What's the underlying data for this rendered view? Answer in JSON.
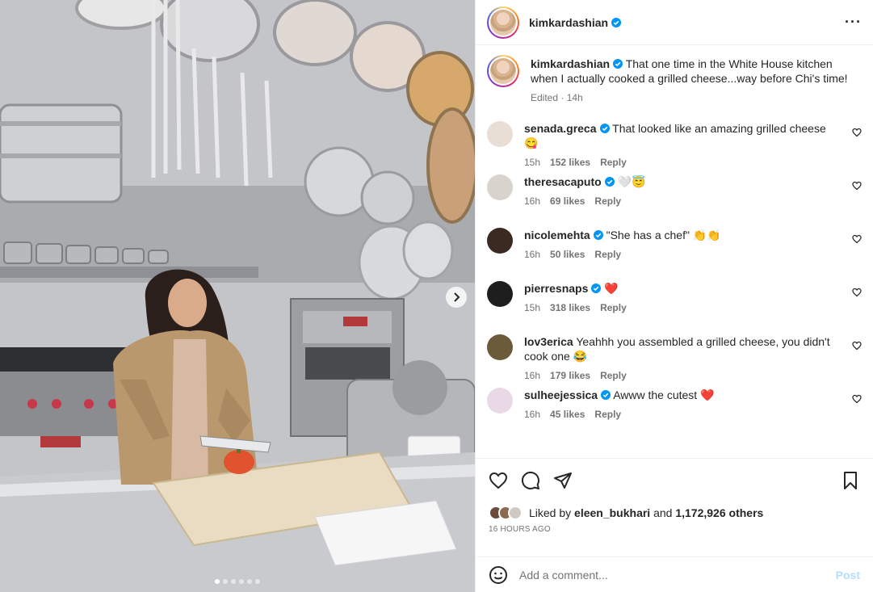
{
  "post": {
    "author": "kimkardashian",
    "caption": "That one time in the White House kitchen when I actually cooked a grilled cheese...way before Chi's time!",
    "edited_label": "Edited · 14h",
    "carousel_dots": 6,
    "active_dot": 0
  },
  "comments": [
    {
      "user": "senada.greca",
      "verified": true,
      "text": "That looked like an amazing grilled cheese 😋",
      "age": "15h",
      "likes": "152 likes",
      "reply": "Reply",
      "avatar_color": "#e8ded6"
    },
    {
      "user": "theresacaputo",
      "verified": true,
      "text": "🤍😇",
      "age": "16h",
      "likes": "69 likes",
      "reply": "Reply",
      "avatar_color": "#d8d3cd"
    },
    {
      "user": "nicolemehta",
      "verified": true,
      "text": "\"She has a chef\" 👏👏",
      "age": "16h",
      "likes": "50 likes",
      "reply": "Reply",
      "avatar_color": "#3a2a22"
    },
    {
      "user": "pierresnaps",
      "verified": true,
      "text": "❤️",
      "age": "15h",
      "likes": "318 likes",
      "reply": "Reply",
      "avatar_color": "#1e1e1e"
    },
    {
      "user": "lov3erica",
      "verified": false,
      "text": "Yeahhh you assembled a grilled cheese, you didn't cook one 😂",
      "age": "16h",
      "likes": "179 likes",
      "reply": "Reply",
      "avatar_color": "#6b5b3a"
    },
    {
      "user": "sulheejessica",
      "verified": true,
      "text": "Awww the cutest ❤️",
      "age": "16h",
      "likes": "45 likes",
      "reply": "Reply",
      "avatar_color": "#e9d9e6"
    }
  ],
  "likes": {
    "prefix": "Liked by",
    "by_user": "eleen_bukhari",
    "and_word": "and",
    "others": "1,172,926 others",
    "time": "16 HOURS AGO"
  },
  "composer": {
    "placeholder": "Add a comment...",
    "post_label": "Post"
  },
  "colors": {
    "verified": "#0095f6",
    "heart_red": "#ed4956",
    "post_disabled": "#b2dffc"
  }
}
